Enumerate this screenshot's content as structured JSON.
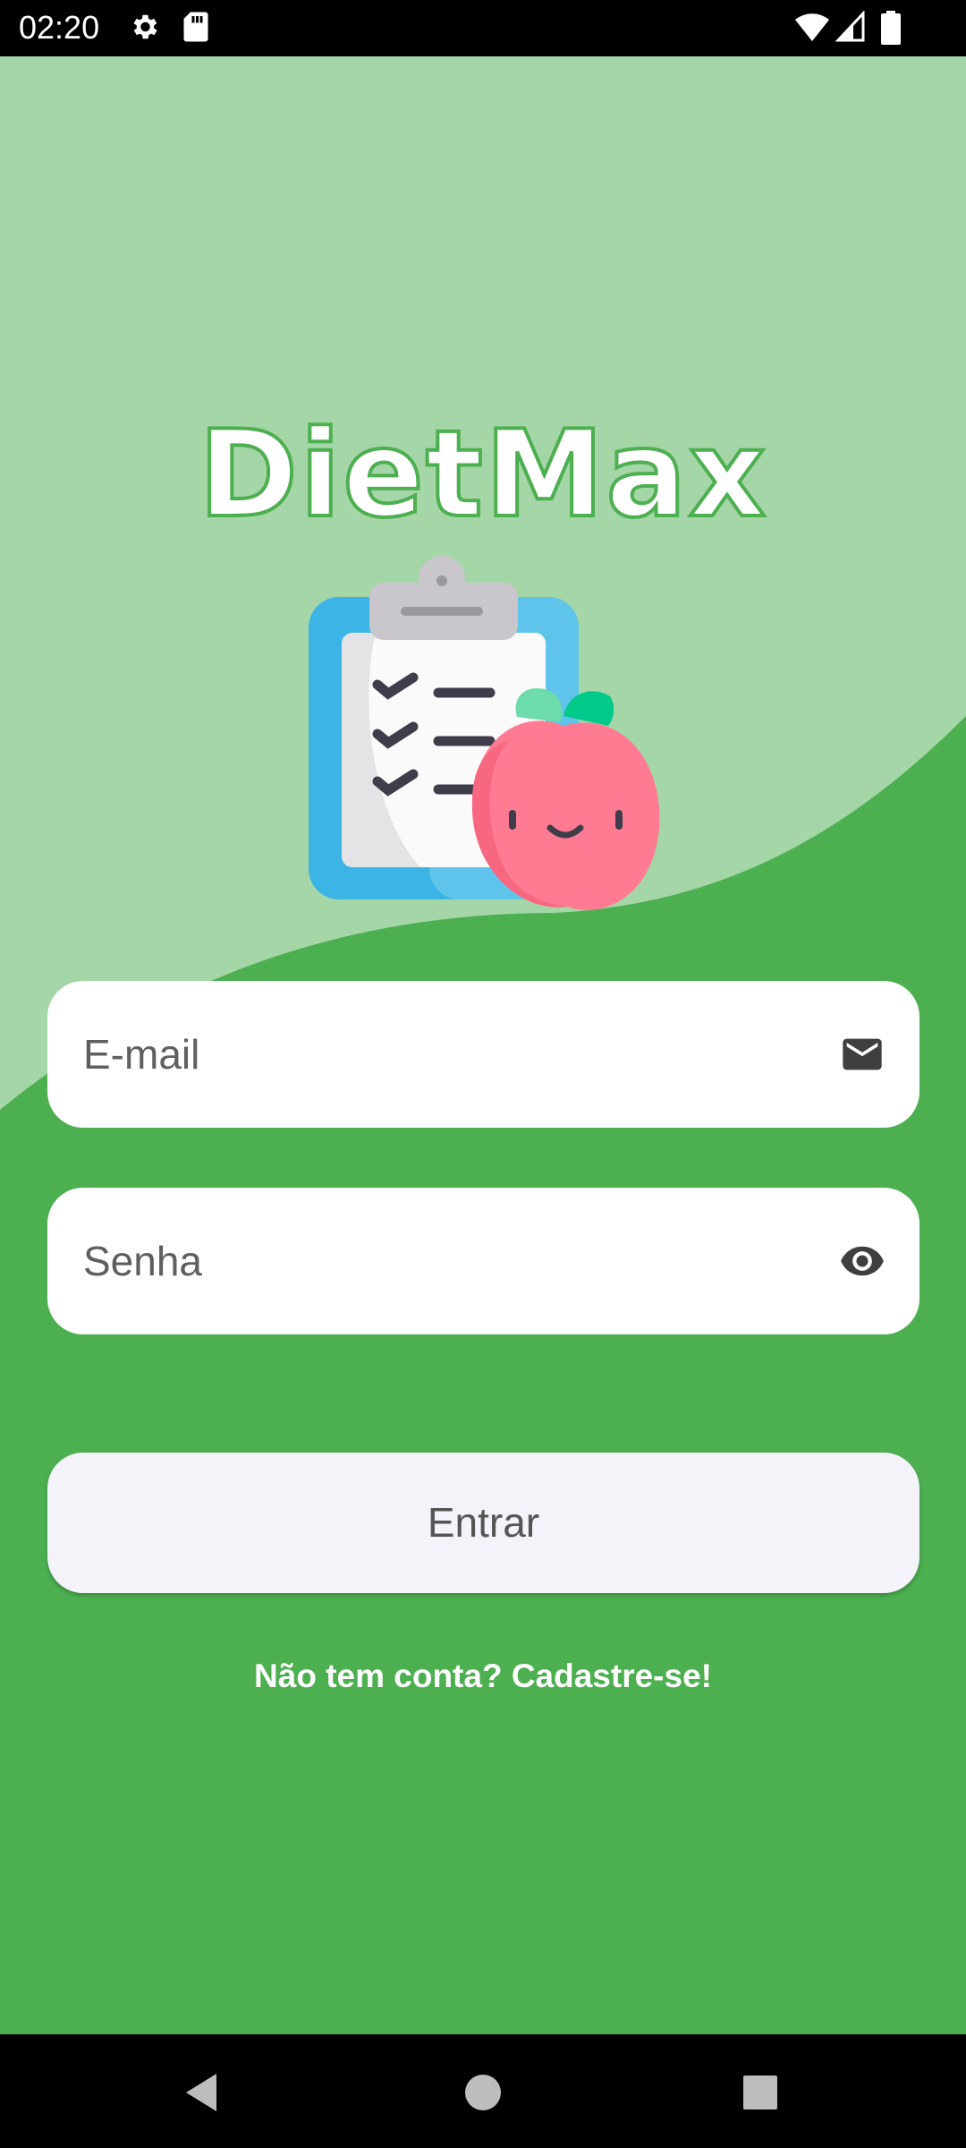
{
  "status_bar": {
    "time": "02:20",
    "icons": [
      "gear-icon",
      "sd-card-icon",
      "wifi-icon",
      "signal-icon",
      "battery-icon"
    ]
  },
  "app": {
    "logo_text": "DietMax",
    "colors": {
      "light_green": "#a5d6a7",
      "green": "#4caf50",
      "white": "#ffffff"
    }
  },
  "form": {
    "email": {
      "value": "",
      "placeholder": "E-mail",
      "icon": "mail-icon"
    },
    "password": {
      "value": "",
      "placeholder": "Senha",
      "icon": "eye-icon"
    },
    "submit_label": "Entrar",
    "signup_label": "Não tem conta? Cadastre-se!"
  },
  "nav_bar": {
    "buttons": [
      "back-icon",
      "home-icon",
      "recents-icon"
    ]
  }
}
